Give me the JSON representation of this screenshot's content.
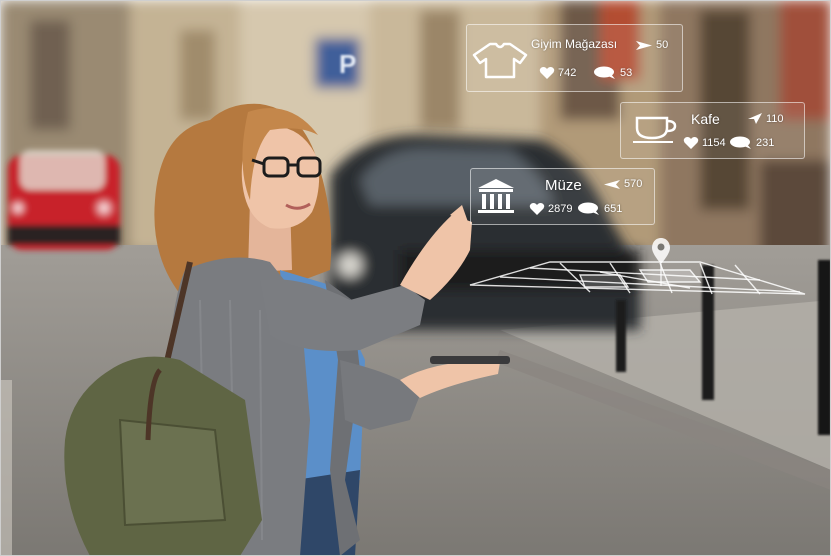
{
  "overlay": {
    "cards": [
      {
        "id": "clothing",
        "icon": "shirt-icon",
        "name": "Giyim Mağazası",
        "distance": "50",
        "likes": "742",
        "comments": "53"
      },
      {
        "id": "cafe",
        "icon": "coffee-cup-icon",
        "name": "Kafe",
        "distance": "110",
        "likes": "1154",
        "comments": "231"
      },
      {
        "id": "museum",
        "icon": "museum-icon",
        "name": "Müze",
        "distance": "570",
        "likes": "2879",
        "comments": "651"
      }
    ],
    "map_marker": "map-pin-icon"
  },
  "colors": {
    "overlay_line": "#ffffff",
    "street": "#8c8a86",
    "sweater": "#7a7c80",
    "bag": "#5f6544",
    "hair": "#b9804a",
    "shirt": "#5b8fc9",
    "car": "#c8242b"
  }
}
